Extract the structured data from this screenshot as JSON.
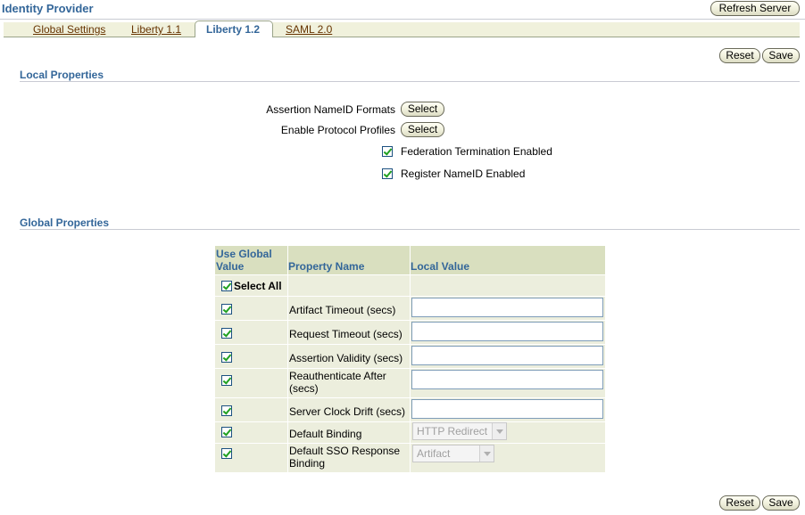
{
  "header": {
    "title": "Identity Provider",
    "refresh_label": "Refresh Server"
  },
  "tabs": [
    {
      "label": "Global Settings",
      "active": false
    },
    {
      "label": "Liberty 1.1",
      "active": false
    },
    {
      "label": "Liberty 1.2",
      "active": true
    },
    {
      "label": "SAML 2.0",
      "active": false
    }
  ],
  "actions": {
    "reset_label": "Reset",
    "save_label": "Save"
  },
  "local_properties": {
    "heading": "Local Properties",
    "nameid_formats_label": "Assertion NameID Formats",
    "protocol_profiles_label": "Enable Protocol Profiles",
    "select_label": "Select",
    "federation_termination": {
      "label": "Federation Termination Enabled",
      "checked": true
    },
    "register_nameid": {
      "label": "Register NameID Enabled",
      "checked": true
    }
  },
  "global_properties": {
    "heading": "Global Properties",
    "columns": {
      "use_global_line1": "Use Global",
      "use_global_line2": "Value",
      "property_name": "Property Name",
      "local_value": "Local Value"
    },
    "select_all_label": "Select All",
    "rows": [
      {
        "name": "Artifact Timeout (secs)",
        "use_global": true,
        "local_value": ""
      },
      {
        "name": "Request Timeout (secs)",
        "use_global": true,
        "local_value": ""
      },
      {
        "name": "Assertion Validity (secs)",
        "use_global": true,
        "local_value": ""
      },
      {
        "name_line1": "Reauthenticate After",
        "name_line2": "(secs)",
        "use_global": true,
        "local_value": ""
      },
      {
        "name": "Server Clock Drift (secs)",
        "use_global": true,
        "local_value": ""
      },
      {
        "name": "Default Binding",
        "use_global": true,
        "local_value": "HTTP Redirect"
      },
      {
        "name_line1": "Default SSO Response",
        "name_line2": "Binding",
        "use_global": true,
        "local_value": "Artifact"
      }
    ]
  }
}
